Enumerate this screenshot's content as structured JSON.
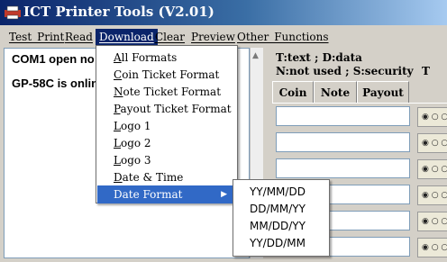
{
  "window": {
    "title": "ICT Printer Tools (V2.01)"
  },
  "menubar": [
    {
      "label": "Test_Print",
      "ul": "T"
    },
    {
      "label": "Read",
      "ul": "R"
    },
    {
      "label": "Download",
      "ul": "D"
    },
    {
      "label": "Clear",
      "ul": "C"
    },
    {
      "label": "Preview",
      "ul": "P"
    },
    {
      "label": "Other_Functions",
      "ul": "O"
    }
  ],
  "log": {
    "line1": "COM1  open no",
    "line2": "GP-58C is onlin"
  },
  "right": {
    "legend1": "T:text ; D:data",
    "legend2": "N:not used ; S:security",
    "t_label": "T",
    "tabs": [
      "Coin",
      "Note",
      "Payout"
    ],
    "option_text": "◉ ○ ○"
  },
  "download_menu": [
    {
      "label": "All Formats",
      "ul": "A",
      "rest": "ll Formats"
    },
    {
      "label": "Coin Ticket Format",
      "ul": "C",
      "rest": "oin Ticket Format"
    },
    {
      "label": "Note Ticket Format",
      "ul": "N",
      "rest": "ote Ticket Format"
    },
    {
      "label": "Payout Ticket Format",
      "ul": "P",
      "rest": "ayout Ticket Format"
    },
    {
      "label": "Logo 1",
      "ul": "L",
      "rest": "ogo 1"
    },
    {
      "label": "Logo 2",
      "ul": "L",
      "rest": "ogo 2"
    },
    {
      "label": "Logo 3",
      "ul": "L",
      "rest": "ogo 3"
    },
    {
      "label": "Date & Time",
      "ul": "D",
      "rest": "ate & Time"
    },
    {
      "label": "Date Format",
      "ul": "",
      "rest": "Date Format",
      "active": true,
      "submenu": true
    }
  ],
  "date_format_submenu": [
    "YY/MM/DD",
    "DD/MM/YY",
    "MM/DD/YY",
    "YY/DD/MM"
  ],
  "colors": {
    "highlight": "#3169c6",
    "menubar_active": "#0a246a",
    "title_start": "#0a246a"
  },
  "icons": {
    "app": "printer-app-icon",
    "submenu": "triangle-right-icon",
    "scroll": "scroll-up-arrow-icon"
  }
}
